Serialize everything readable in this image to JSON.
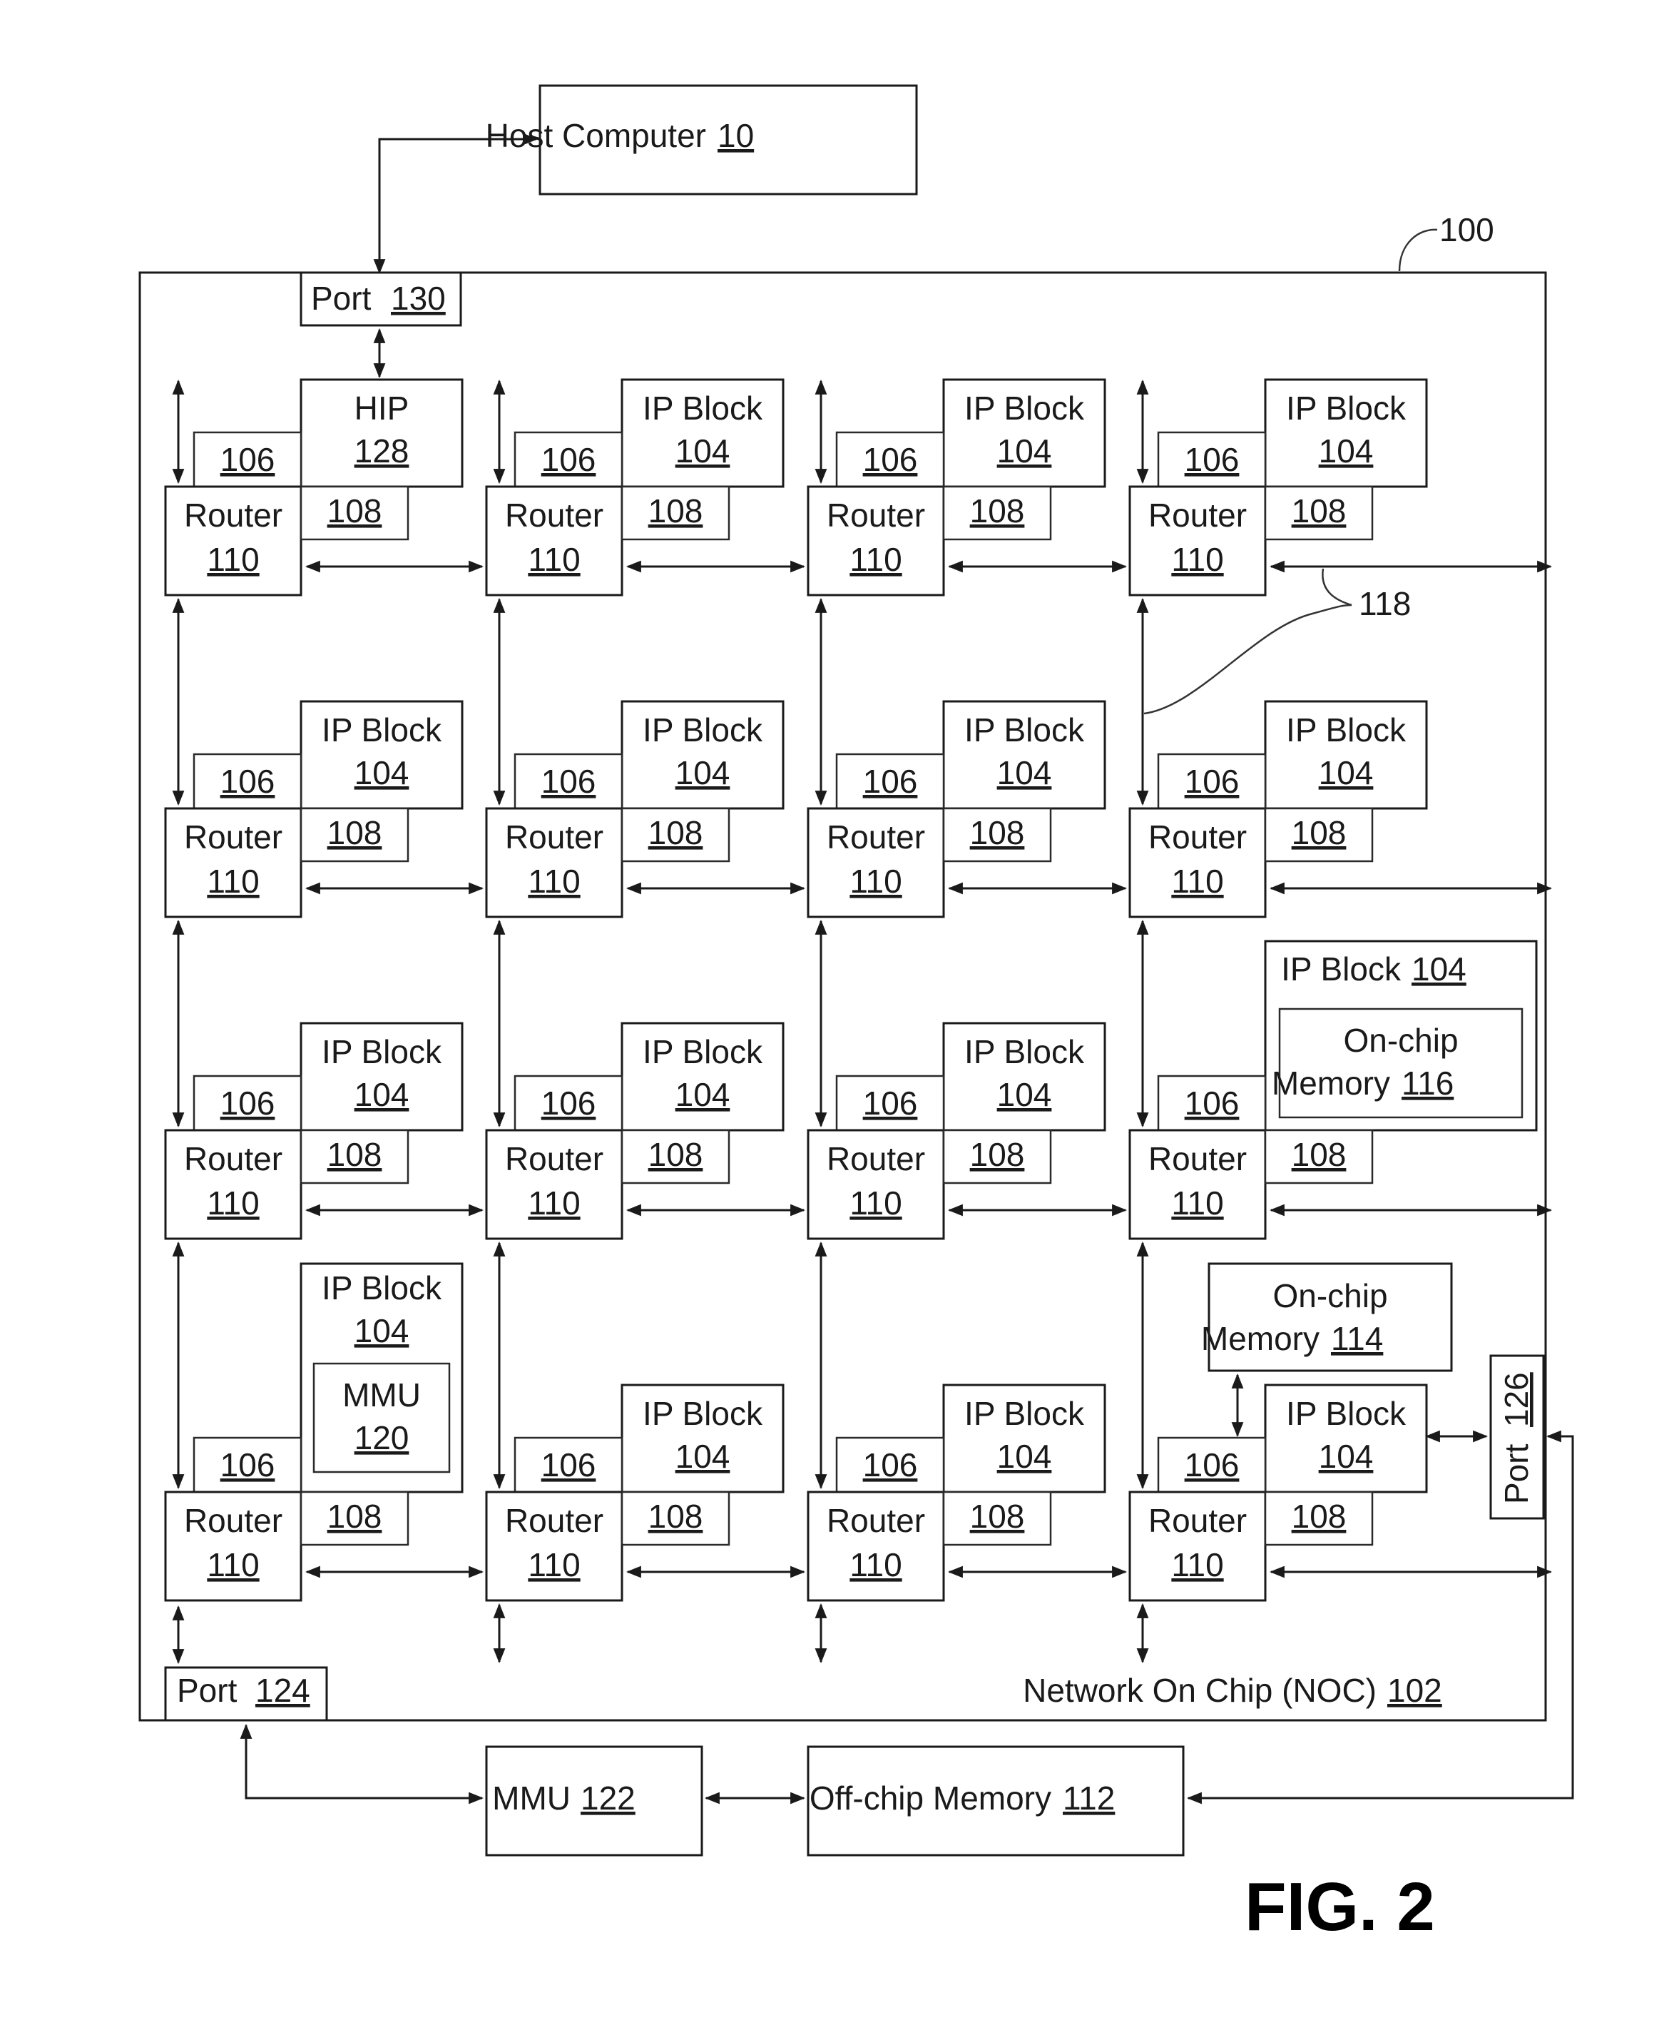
{
  "figure": {
    "caption": "FIG. 2",
    "system_ref": "100",
    "link_ref": "118"
  },
  "host": {
    "label": "Host Computer",
    "ref": "10"
  },
  "noc": {
    "label": "Network On Chip (NOC)",
    "ref": "102"
  },
  "ports": {
    "port130": {
      "label": "Port",
      "ref": "130"
    },
    "port124": {
      "label": "Port",
      "ref": "124"
    },
    "port126": {
      "label": "Port",
      "ref": "126"
    }
  },
  "hip": {
    "label": "HIP",
    "ref": "128"
  },
  "grid": {
    "router_label": "Router",
    "router_ref": "110",
    "ip_label": "IP Block",
    "ip_ref": "104",
    "mem_ctrl_ref": "106",
    "net_adapter_ref": "108",
    "rows": 4,
    "cols": 4
  },
  "onchip116": {
    "label_line1": "On-chip",
    "label_line2": "Memory",
    "ref": "116",
    "container_label": "IP Block",
    "container_ref": "104"
  },
  "onchip114": {
    "label_line1": "On-chip",
    "label_line2": "Memory",
    "ref": "114"
  },
  "mmu120": {
    "label": "MMU",
    "ref": "120"
  },
  "mmu122": {
    "label": "MMU",
    "ref": "122"
  },
  "offchip112": {
    "label": "Off-chip  Memory",
    "ref": "112"
  }
}
